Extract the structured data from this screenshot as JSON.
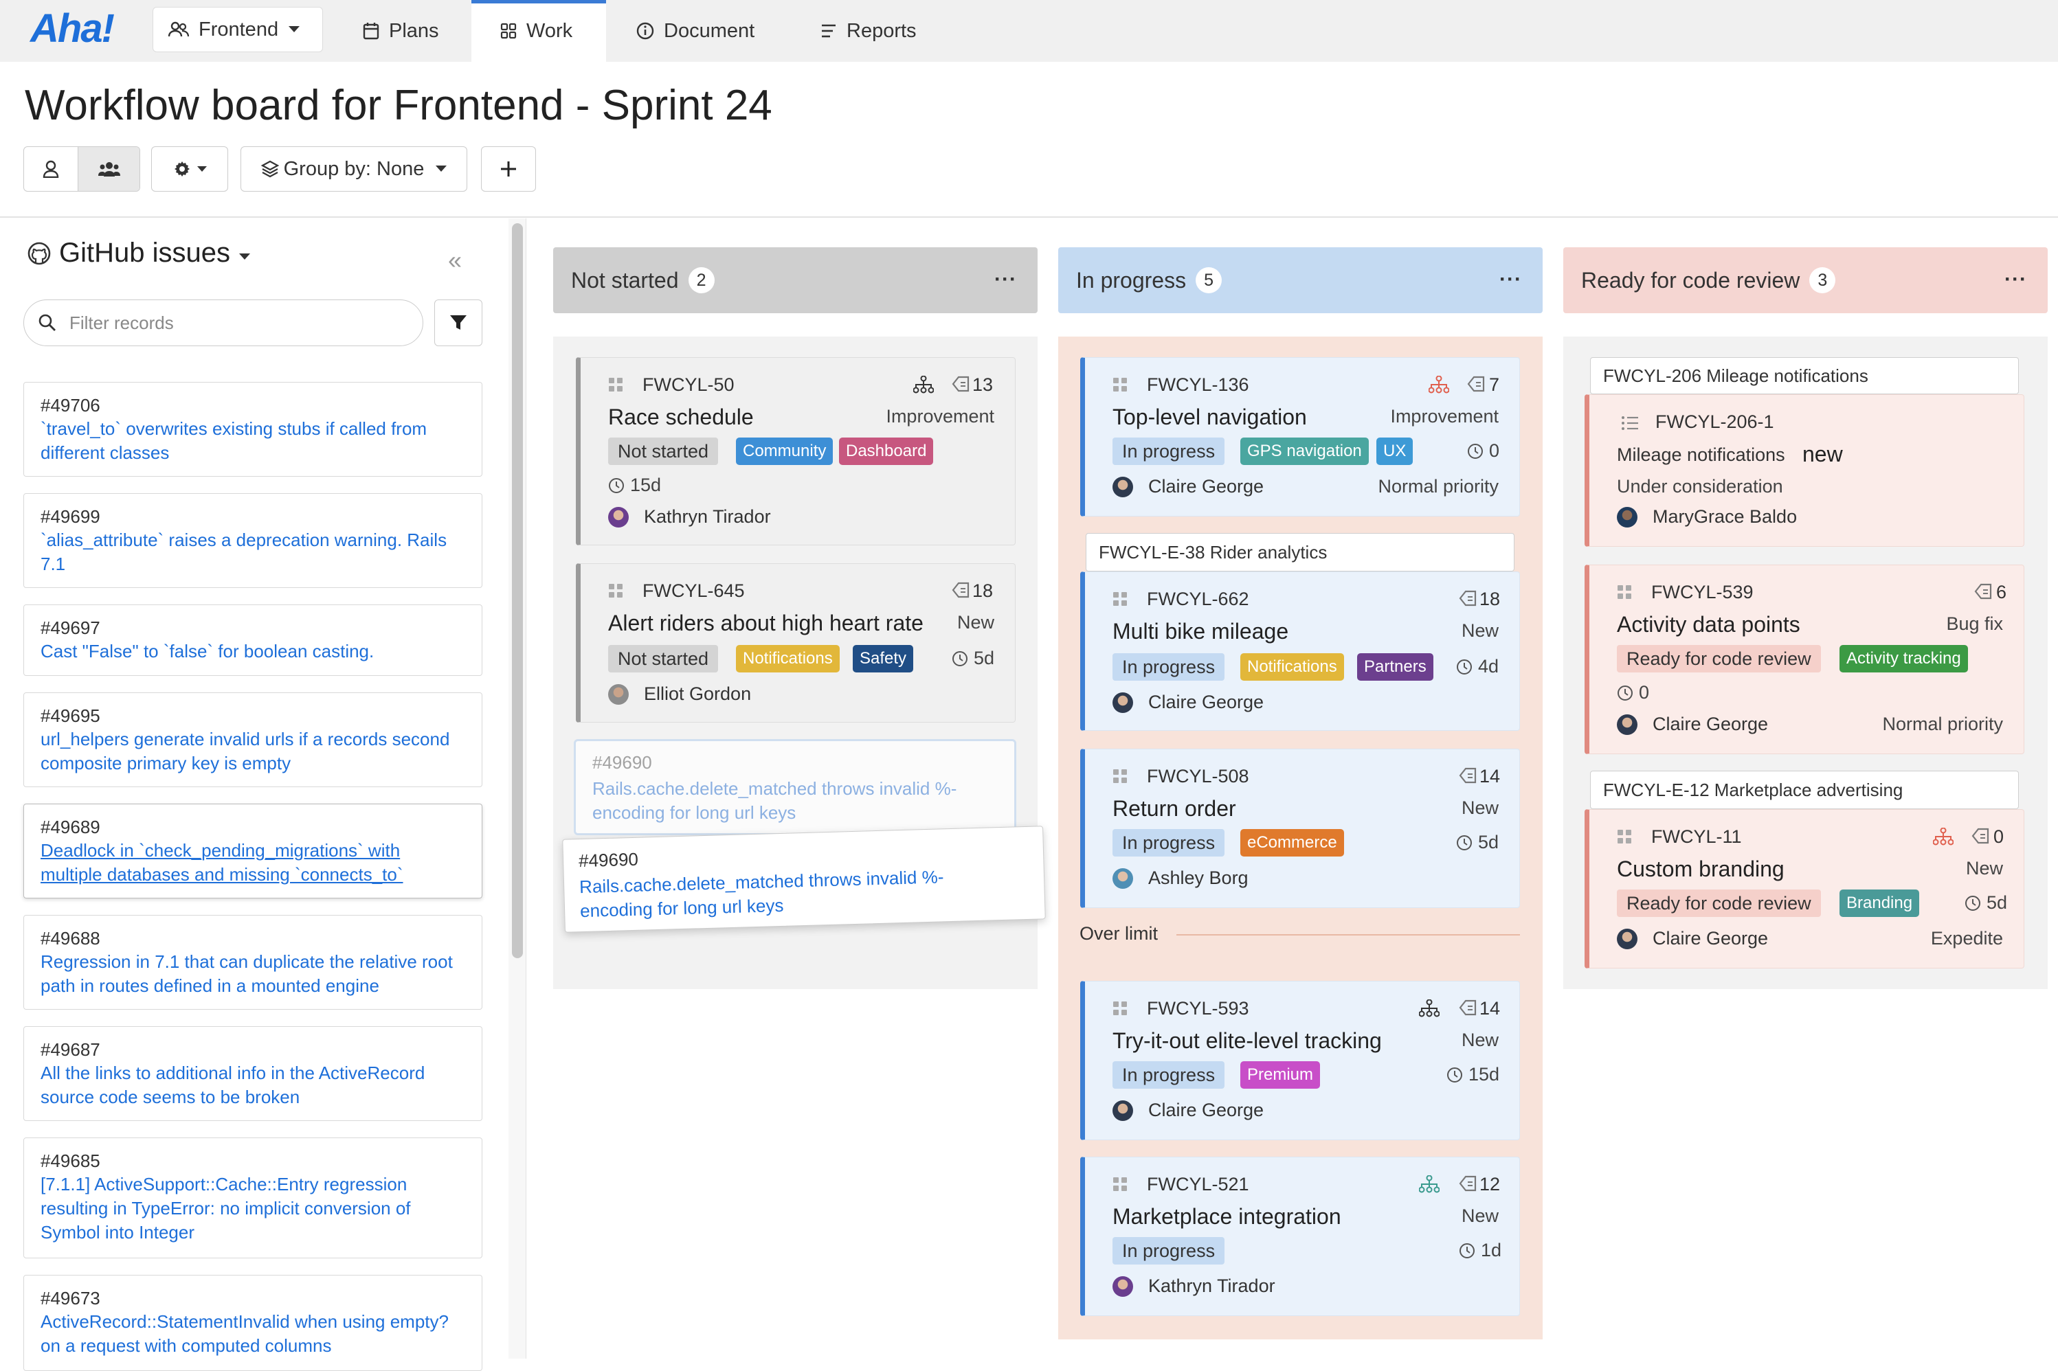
{
  "app": {
    "logo": "Aha!"
  },
  "nav": {
    "product": "Frontend",
    "tabs": [
      {
        "label": "Plans",
        "icon": "calendar-icon"
      },
      {
        "label": "Work",
        "icon": "grid-icon",
        "active": true
      },
      {
        "label": "Document",
        "icon": "info-icon"
      },
      {
        "label": "Reports",
        "icon": "report-icon"
      }
    ]
  },
  "page": {
    "title": "Workflow board for Frontend - Sprint 24"
  },
  "toolbar": {
    "group_by": "Group by: None"
  },
  "sidebar": {
    "title": "GitHub issues",
    "filter_placeholder": "Filter records",
    "issues": [
      {
        "num": "#49706",
        "text": "`travel_to` overwrites existing stubs if called from different classes"
      },
      {
        "num": "#49699",
        "text": "`alias_attribute` raises a deprecation warning. Rails 7.1"
      },
      {
        "num": "#49697",
        "text": "Cast \"False\" to `false` for boolean casting."
      },
      {
        "num": "#49695",
        "text": "url_helpers generate invalid urls if a records second composite primary key is empty"
      },
      {
        "num": "#49689",
        "text": "Deadlock in `check_pending_migrations` with multiple databases and missing `connects_to`"
      },
      {
        "num": "#49688",
        "text": "Regression in 7.1 that can duplicate the relative root path in routes defined in a mounted engine"
      },
      {
        "num": "#49687",
        "text": "All the links to additional info in the ActiveRecord source code seems to be broken"
      },
      {
        "num": "#49685",
        "text": "[7.1.1] ActiveSupport::Cache::Entry regression resulting in TypeError: no implicit conversion of Symbol into Integer"
      },
      {
        "num": "#49673",
        "text": "ActiveRecord::StatementInvalid when using empty? on a request with computed columns"
      }
    ]
  },
  "columns": {
    "not_started": {
      "title": "Not started",
      "count": "2",
      "cards": [
        {
          "id": "FWCYL-50",
          "title": "Race schedule",
          "type": "Improvement",
          "status": "Not started",
          "tags": [
            "Community",
            "Dashboard"
          ],
          "score": "13",
          "time": "15d",
          "assignee": "Kathryn Tirador"
        },
        {
          "id": "FWCYL-645",
          "title": "Alert riders about high heart rate",
          "type": "New",
          "status": "Not started",
          "tags": [
            "Notifications",
            "Safety"
          ],
          "score": "18",
          "time": "5d",
          "assignee": "Elliot Gordon"
        }
      ],
      "drag_ghost": {
        "num": "#49690",
        "text": "Rails.cache.delete_matched throws invalid %-encoding for long url keys"
      },
      "dragging": {
        "num": "#49690",
        "text": "Rails.cache.delete_matched throws invalid %-encoding for long url keys"
      }
    },
    "in_progress": {
      "title": "In progress",
      "count": "5",
      "cards": [
        {
          "id": "FWCYL-136",
          "title": "Top-level navigation",
          "type": "Improvement",
          "status": "In progress",
          "tags": [
            "GPS navigation",
            "UX"
          ],
          "score": "7",
          "time": "0",
          "assignee": "Claire George",
          "priority": "Normal priority"
        },
        {
          "id": "FWCYL-662",
          "title": "Multi bike mileage",
          "type": "New",
          "status": "In progress",
          "tags": [
            "Notifications",
            "Partners"
          ],
          "score": "18",
          "time": "4d",
          "assignee": "Claire George"
        },
        {
          "id": "FWCYL-508",
          "title": "Return order",
          "type": "New",
          "status": "In progress",
          "tags": [
            "eCommerce"
          ],
          "score": "14",
          "time": "5d",
          "assignee": "Ashley Borg"
        },
        {
          "id": "FWCYL-593",
          "title": "Try-it-out elite-level tracking",
          "type": "New",
          "status": "In progress",
          "tags": [
            "Premium"
          ],
          "score": "14",
          "time": "15d",
          "assignee": "Claire George"
        },
        {
          "id": "FWCYL-521",
          "title": "Marketplace integration",
          "type": "New",
          "status": "In progress",
          "tags": [],
          "score": "12",
          "time": "1d",
          "assignee": "Kathryn Tirador"
        }
      ],
      "group": "FWCYL-E-38 Rider analytics",
      "over_limit": "Over limit"
    },
    "ready_review": {
      "title": "Ready for code review",
      "count": "3",
      "groups": [
        "FWCYL-206 Mileage notifications",
        "FWCYL-E-12 Marketplace advertising"
      ],
      "cards": [
        {
          "id": "FWCYL-206-1",
          "title": "Mileage notifications",
          "badge": "new",
          "status": "Under consideration",
          "assignee": "MaryGrace Baldo"
        },
        {
          "id": "FWCYL-539",
          "title": "Activity data points",
          "type": "Bug fix",
          "status": "Ready for code review",
          "tags": [
            "Activity tracking"
          ],
          "score": "6",
          "time": "0",
          "assignee": "Claire George",
          "priority": "Normal priority"
        },
        {
          "id": "FWCYL-11",
          "title": "Custom branding",
          "type": "New",
          "status": "Ready for code review",
          "tags": [
            "Branding"
          ],
          "score": "0",
          "time": "5d",
          "assignee": "Claire George",
          "priority": "Expedite"
        }
      ]
    }
  },
  "colors": {
    "accent": "#1e6fd9",
    "not_started": "#cfcfcf",
    "in_progress": "#c4daf2",
    "ready": "#f5d6d2"
  }
}
